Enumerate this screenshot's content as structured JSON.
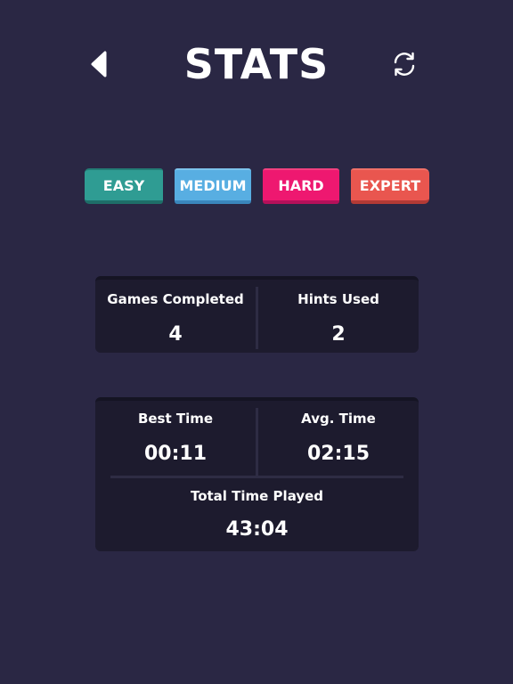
{
  "header": {
    "title": "STATS",
    "back_icon": "chevron-left-icon",
    "refresh_icon": "refresh-icon"
  },
  "difficulty_tabs": [
    {
      "label": "EASY",
      "color": "#2f9c93"
    },
    {
      "label": "MEDIUM",
      "color": "#58aee2"
    },
    {
      "label": "HARD",
      "color": "#ee1870"
    },
    {
      "label": "EXPERT",
      "color": "#e9564f"
    }
  ],
  "stats": {
    "games_completed": {
      "label": "Games Completed",
      "value": "4"
    },
    "hints_used": {
      "label": "Hints Used",
      "value": "2"
    },
    "best_time": {
      "label": "Best Time",
      "value": "00:11"
    },
    "avg_time": {
      "label": "Avg. Time",
      "value": "02:15"
    },
    "total_time": {
      "label": "Total Time Played",
      "value": "43:04"
    }
  },
  "colors": {
    "background": "#2a2744",
    "card": "#1d1b2e"
  }
}
